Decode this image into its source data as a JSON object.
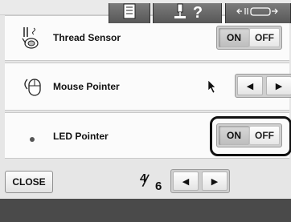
{
  "settings": {
    "rows": [
      {
        "label": "Thread Sensor",
        "icon": "thread-sensor-icon",
        "on": "ON",
        "off": "OFF",
        "selected": "ON"
      },
      {
        "label": "Mouse Pointer",
        "icon": "mouse-icon",
        "left": "◀",
        "right": "▶"
      },
      {
        "label": "LED Pointer",
        "icon": "led-dot-icon",
        "on": "ON",
        "off": "OFF",
        "selected": "ON"
      }
    ]
  },
  "footer": {
    "close_label": "CLOSE",
    "page_current": "4",
    "page_total": "6",
    "prev": "◀",
    "next": "▶"
  },
  "taskbar": {
    "items": [
      {
        "icon": "document-list-icon"
      },
      {
        "icon": "sewing-help-icon",
        "label": "?"
      },
      {
        "icon": "machine-frame-icon"
      }
    ]
  },
  "colors": {
    "panel": "#fbfbfb",
    "background": "#e6e6e6",
    "taskbar": "#4a4a4a",
    "highlight": "#111111"
  }
}
